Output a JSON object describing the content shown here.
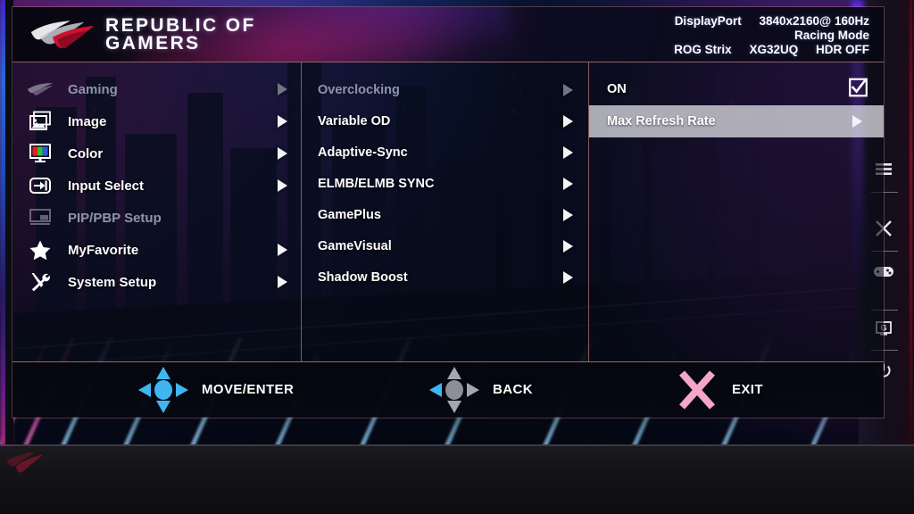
{
  "osd": {
    "brand": {
      "line1": "REPUBLIC OF",
      "line2": "GAMERS",
      "logo_icon": "rog-logo-icon"
    },
    "status": {
      "source": "DisplayPort",
      "resolution": "3840x2160@ 160Hz",
      "mode": "Racing Mode",
      "model_series": "ROG Strix",
      "model": "XG32UQ",
      "hdr": "HDR OFF"
    },
    "sidebar": {
      "items": [
        {
          "label": "Gaming",
          "icon": "rog-eye-icon",
          "dim": true,
          "arrow": true
        },
        {
          "label": "Image",
          "icon": "image-icon",
          "dim": false,
          "arrow": true
        },
        {
          "label": "Color",
          "icon": "color-bars-icon",
          "dim": false,
          "arrow": true
        },
        {
          "label": "Input Select",
          "icon": "input-arrow-icon",
          "dim": false,
          "arrow": true
        },
        {
          "label": "PIP/PBP Setup",
          "icon": "pip-pbp-icon",
          "dim": true,
          "arrow": false
        },
        {
          "label": "MyFavorite",
          "icon": "star-icon",
          "dim": false,
          "arrow": true
        },
        {
          "label": "System Setup",
          "icon": "tools-icon",
          "dim": false,
          "arrow": true
        }
      ]
    },
    "submenu": {
      "items": [
        {
          "label": "Overclocking",
          "dim": true,
          "arrow": true
        },
        {
          "label": "Variable OD",
          "dim": false,
          "arrow": true
        },
        {
          "label": "Adaptive-Sync",
          "dim": false,
          "arrow": true
        },
        {
          "label": "ELMB/ELMB SYNC",
          "dim": false,
          "arrow": true
        },
        {
          "label": "GamePlus",
          "dim": false,
          "arrow": true
        },
        {
          "label": "GameVisual",
          "dim": false,
          "arrow": true
        },
        {
          "label": "Shadow Boost",
          "dim": false,
          "arrow": true
        }
      ]
    },
    "options": {
      "items": [
        {
          "label": "ON",
          "selected": false,
          "control": "checkbox-checked",
          "icon": "checkbox-checked-icon"
        },
        {
          "label": "Max Refresh Rate",
          "selected": true,
          "control": "arrow",
          "icon": "chevron-right-icon"
        }
      ]
    },
    "footer": {
      "actions": [
        {
          "label": "MOVE/ENTER",
          "icon": "joystick-4way-blue-icon"
        },
        {
          "label": "BACK",
          "icon": "joystick-4way-gray-icon"
        },
        {
          "label": "EXIT",
          "icon": "close-x-icon"
        }
      ]
    }
  },
  "bezel": {
    "buttons": [
      {
        "icon": "menu-hamburger-icon",
        "name": "menu-button"
      },
      {
        "icon": "close-x-icon",
        "name": "close-button"
      },
      {
        "icon": "gamepad-icon",
        "name": "gameplus-button"
      },
      {
        "icon": "gamevisual-g-icon",
        "name": "gamevisual-button"
      },
      {
        "icon": "power-icon",
        "name": "power-button"
      }
    ]
  },
  "colors": {
    "accent_divider": "#ff9a90",
    "highlight_bar": "#e2e4ea",
    "exit_x": "#f4a6c6",
    "joystick_blue": "#3fb6ef",
    "joystick_gray": "#a6a6ae",
    "text_primary": "#ffffff",
    "text_dim": "#8d95a6"
  }
}
